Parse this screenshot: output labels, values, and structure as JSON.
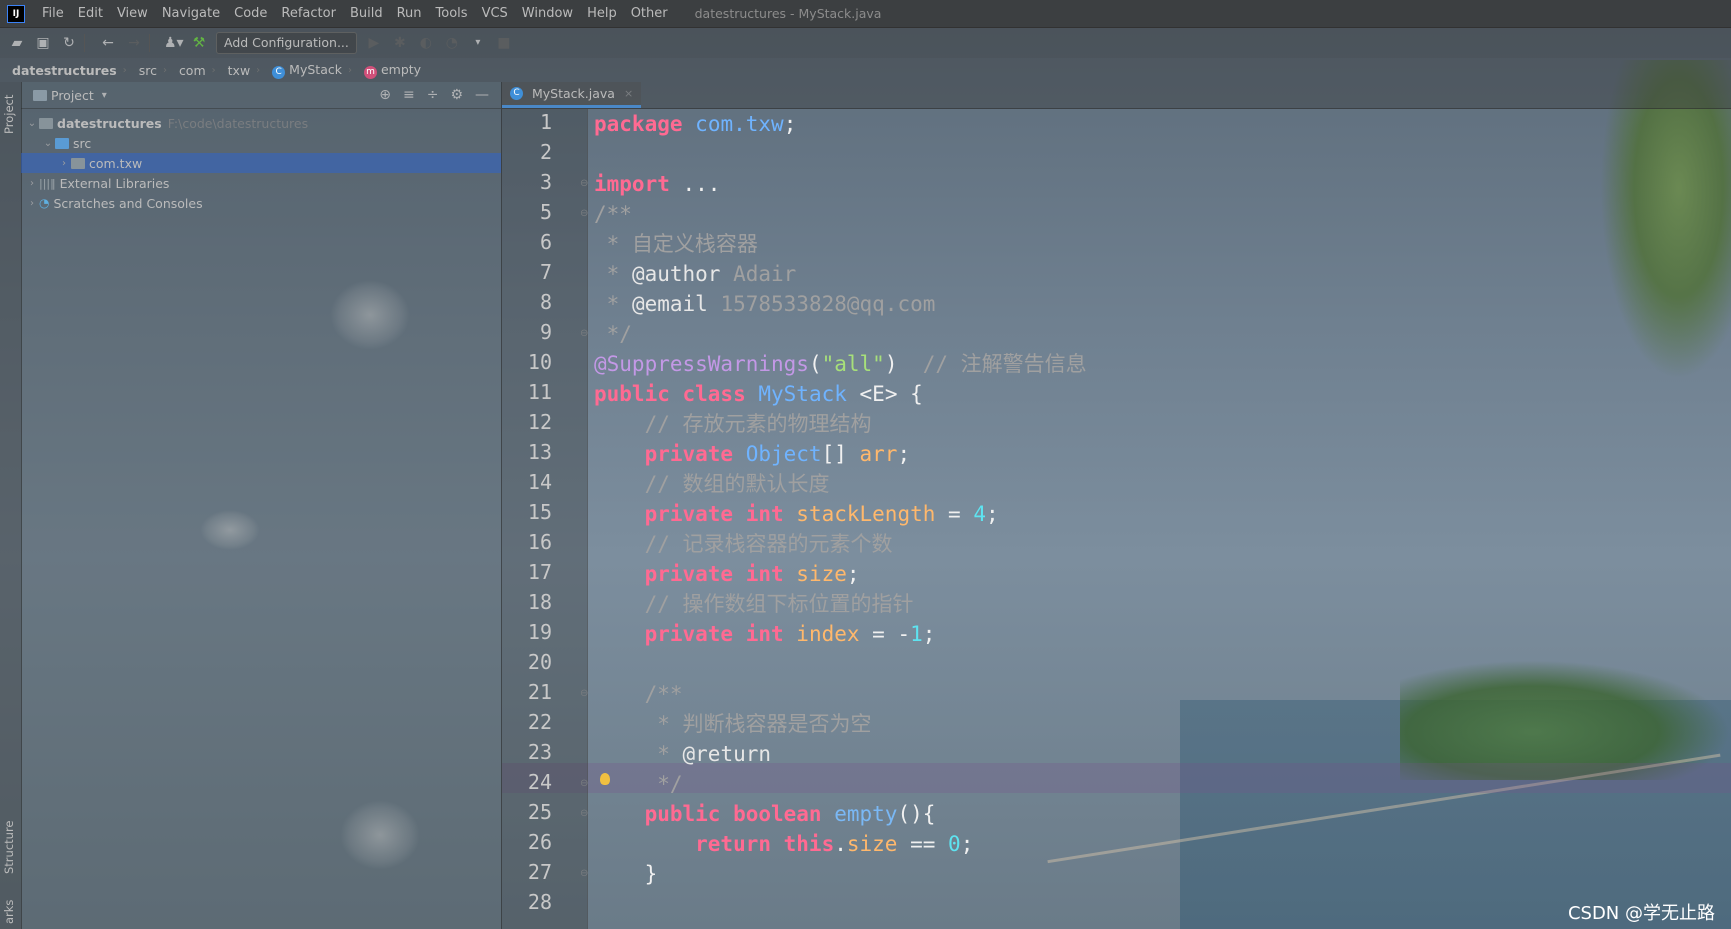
{
  "menubar": {
    "items": [
      "File",
      "Edit",
      "View",
      "Navigate",
      "Code",
      "Refactor",
      "Build",
      "Run",
      "Tools",
      "VCS",
      "Window",
      "Help",
      "Other"
    ],
    "window_title": "datestructures - MyStack.java"
  },
  "toolbar": {
    "add_config_label": "Add Configuration..."
  },
  "breadcrumb": {
    "items": [
      "datestructures",
      "src",
      "com",
      "txw",
      "MyStack",
      "empty"
    ]
  },
  "left_strip": {
    "project_label": "Project",
    "structure_label": "Structure",
    "bookmarks_label": "arks"
  },
  "project_panel": {
    "title": "Project",
    "tree": [
      {
        "label": "datestructures",
        "hint": "F:\\code\\datestructures"
      },
      {
        "label": "src"
      },
      {
        "label": "com.txw"
      },
      {
        "label": "External Libraries"
      },
      {
        "label": "Scratches and Consoles"
      }
    ]
  },
  "editor": {
    "tab_label": "MyStack.java",
    "line_numbers": [
      "1",
      "2",
      "3",
      "5",
      "6",
      "7",
      "8",
      "9",
      "10",
      "11",
      "12",
      "13",
      "14",
      "15",
      "16",
      "17",
      "18",
      "19",
      "20",
      "21",
      "22",
      "23",
      "24",
      "25",
      "26",
      "27",
      "28"
    ],
    "code": {
      "l1_kw": "package",
      "l1_pkg": "com.txw",
      "l1_end": ";",
      "l3_kw": "import",
      "l3_rest": " ...",
      "l5": "/**",
      "l6": " * 自定义栈容器",
      "l7_star": " * ",
      "l7_tag": "@author",
      "l7_rest": " Adair",
      "l8_star": " * ",
      "l8_tag": "@email",
      "l8_rest": " 1578533828@qq.com",
      "l9": " */",
      "l10_ann": "@SuppressWarnings",
      "l10_open": "(",
      "l10_str": "\"all\"",
      "l10_close": ")",
      "l10_cmt": "  // 注解警告信息",
      "l11_kw": "public class ",
      "l11_cls": "MyStack",
      "l11_rest": " <E> {",
      "l12": "    // 存放元素的物理结构",
      "l13_kw": "    private ",
      "l13_type": "Object",
      "l13_mid": "[] ",
      "l13_field": "arr",
      "l13_end": ";",
      "l14": "    // 数组的默认长度",
      "l15_kw": "    private int ",
      "l15_field": "stackLength",
      "l15_mid": " = ",
      "l15_num": "4",
      "l15_end": ";",
      "l16": "    // 记录栈容器的元素个数",
      "l17_kw": "    private int ",
      "l17_field": "size",
      "l17_end": ";",
      "l18": "    // 操作数组下标位置的指针",
      "l19_kw": "    private int ",
      "l19_field": "index",
      "l19_mid": " = -",
      "l19_num": "1",
      "l19_end": ";",
      "l21": "    /**",
      "l22": "     * 判断栈容器是否为空",
      "l23_star": "     * ",
      "l23_tag": "@return",
      "l24": "     */",
      "l25_kw": "    public boolean ",
      "l25_method": "empty",
      "l25_rest": "(){",
      "l26_kw": "        return this",
      "l26_dot": ".",
      "l26_field": "size",
      "l26_mid": " == ",
      "l26_num": "0",
      "l26_end": ";",
      "l27": "    }"
    }
  },
  "watermark": "CSDN @学无止路",
  "colors": {
    "keyword": "#ff6a92",
    "type": "#6fb3ff",
    "field": "#ffb86c",
    "number": "#5ee3f0",
    "comment": "#a0a0a0",
    "selection": "#2f65ca"
  }
}
